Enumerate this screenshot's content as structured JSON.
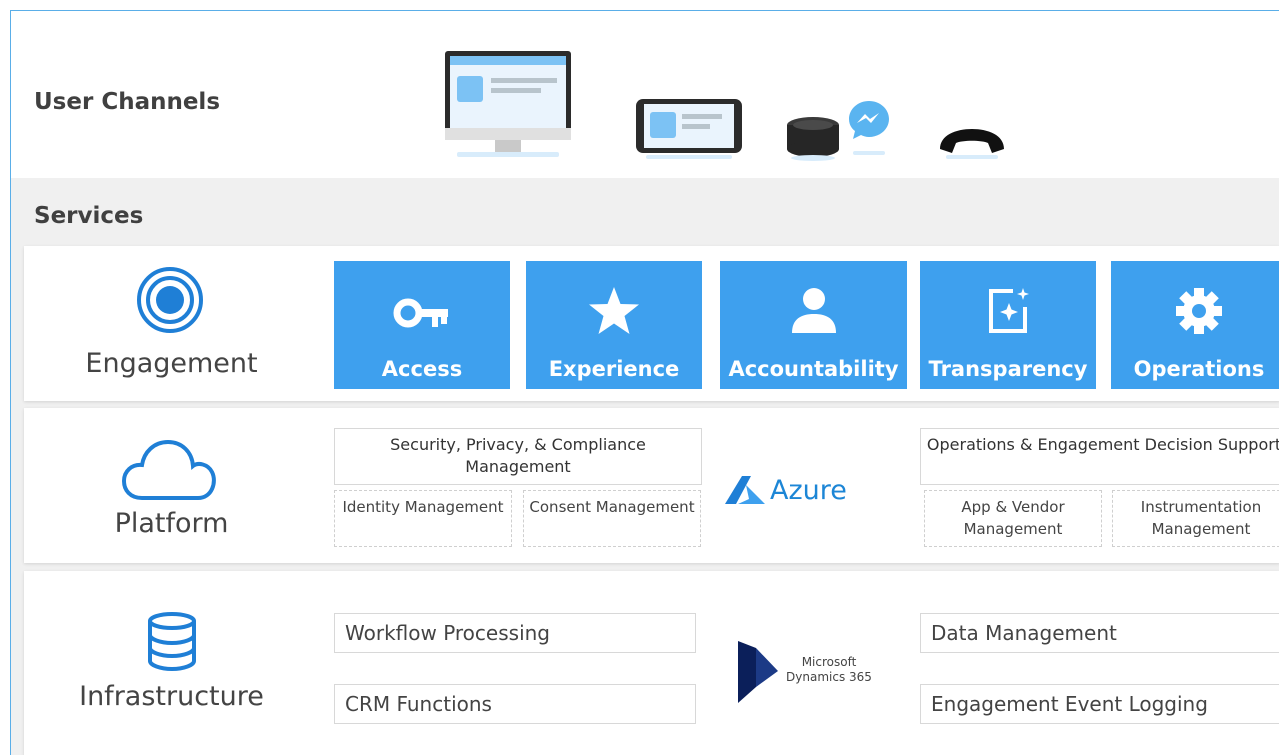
{
  "user_channels": {
    "title": "User Channels",
    "icons": [
      "desktop-monitor-icon",
      "mobile-phone-icon",
      "smart-speaker-icon",
      "messenger-icon",
      "telephone-icon"
    ]
  },
  "services": {
    "title": "Services",
    "engagement": {
      "label": "Engagement",
      "icon": "target-circle-icon",
      "tiles": [
        {
          "label": "Access",
          "icon": "key-icon"
        },
        {
          "label": "Experience",
          "icon": "star-icon"
        },
        {
          "label": "Accountability",
          "icon": "person-icon"
        },
        {
          "label": "Transparency",
          "icon": "sparkle-frame-icon"
        },
        {
          "label": "Operations",
          "icon": "gear-icon"
        }
      ],
      "tile_color": "#3ea0ee"
    },
    "platform": {
      "label": "Platform",
      "icon": "cloud-icon",
      "left_group": {
        "header": "Security, Privacy, & Compliance Management",
        "subs": [
          "Identity Management",
          "Consent Management"
        ]
      },
      "center_logo": "Azure",
      "right_group": {
        "header": "Operations & Engagement Decision Support",
        "subs": [
          "App & Vendor Management",
          "Instrumentation Management"
        ]
      }
    },
    "infrastructure": {
      "label": "Infrastructure",
      "icon": "database-icon",
      "left_items": [
        "Workflow Processing",
        "CRM Functions"
      ],
      "center_logo_lines": [
        "Microsoft",
        "Dynamics 365"
      ],
      "right_items": [
        "Data Management",
        "Engagement Event Logging"
      ]
    }
  }
}
